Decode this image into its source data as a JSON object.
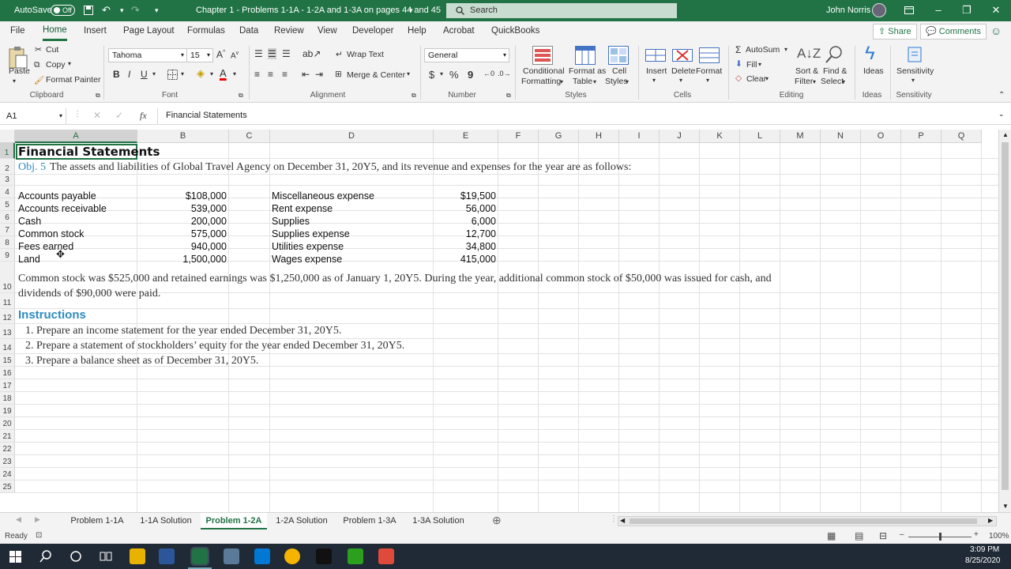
{
  "title_bar": {
    "autosave_label": "AutoSave",
    "autosave_state": "Off",
    "document_title": "Chapter 1 - Problems 1-1A - 1-2A and 1-3A on pages 44 and 45",
    "search_placeholder": "Search",
    "user_name": "John Norris"
  },
  "ribbon_tabs": [
    "File",
    "Home",
    "Insert",
    "Page Layout",
    "Formulas",
    "Data",
    "Review",
    "View",
    "Developer",
    "Help",
    "Acrobat",
    "QuickBooks"
  ],
  "active_tab": "Home",
  "share_label": "Share",
  "comments_label": "Comments",
  "ribbon": {
    "clipboard": {
      "paste": "Paste",
      "cut": "Cut",
      "copy": "Copy",
      "format_painter": "Format Painter",
      "group": "Clipboard"
    },
    "font": {
      "name": "Tahoma",
      "size": "15",
      "bold": "B",
      "italic": "I",
      "underline": "U",
      "group": "Font"
    },
    "alignment": {
      "wrap_text": "Wrap Text",
      "merge_center": "Merge & Center",
      "group": "Alignment"
    },
    "number": {
      "format": "General",
      "currency": "$",
      "percent": "%",
      "comma": "9",
      "group": "Number"
    },
    "styles": {
      "conditional": "Conditional",
      "conditional2": "Formatting",
      "format_as": "Format as",
      "format_as2": "Table",
      "cell": "Cell",
      "cell2": "Styles",
      "group": "Styles"
    },
    "cells": {
      "insert": "Insert",
      "delete": "Delete",
      "format": "Format",
      "group": "Cells"
    },
    "editing": {
      "autosum": "AutoSum",
      "fill": "Fill",
      "clear": "Clear",
      "sort": "Sort &",
      "sort2": "Filter",
      "find": "Find &",
      "find2": "Select",
      "group": "Editing"
    },
    "ideas": {
      "label": "Ideas",
      "group": "Ideas"
    },
    "sensitivity": {
      "label": "Sensitivity",
      "group": "Sensitivity"
    }
  },
  "formula_bar": {
    "name_box": "A1",
    "fx": "fx",
    "content": "Financial Statements"
  },
  "columns": [
    "A",
    "B",
    "C",
    "D",
    "E",
    "F",
    "G",
    "H",
    "I",
    "J",
    "K",
    "L",
    "M",
    "N",
    "O",
    "P",
    "Q"
  ],
  "rows": [
    "1",
    "2",
    "3",
    "4",
    "5",
    "6",
    "7",
    "8",
    "9",
    "10",
    "11",
    "12",
    "13",
    "14",
    "15",
    "16",
    "17",
    "18",
    "19",
    "20",
    "21",
    "22",
    "23",
    "24",
    "25"
  ],
  "sheet": {
    "a1": "Financial Statements",
    "a2_obj": "Obj. 5",
    "a2_text": "The assets and liabilities of Global Travel Agency on December 31, 20Y5, and its revenue and expenses for the year are as follows:",
    "left_items": [
      {
        "label": "Accounts payable",
        "value": "$108,000"
      },
      {
        "label": "Accounts receivable",
        "value": "539,000"
      },
      {
        "label": "Cash",
        "value": "200,000"
      },
      {
        "label": "Common stock",
        "value": "575,000"
      },
      {
        "label": "Fees earned",
        "value": "940,000"
      },
      {
        "label": "Land",
        "value": "1,500,000"
      }
    ],
    "right_items": [
      {
        "label": "Miscellaneous expense",
        "value": "$19,500"
      },
      {
        "label": "Rent expense",
        "value": "56,000"
      },
      {
        "label": "Supplies",
        "value": "6,000"
      },
      {
        "label": "Supplies expense",
        "value": "12,700"
      },
      {
        "label": "Utilities expense",
        "value": "34,800"
      },
      {
        "label": "Wages expense",
        "value": "415,000"
      }
    ],
    "a10_line1": "Common stock was $525,000 and retained earnings was $1,250,000 as of January 1, 20Y5. During the year, additional common stock of $50,000 was issued for cash, and",
    "a10_line2": "dividends of $90,000 were paid.",
    "a11": "Instructions",
    "instructions": [
      "1. Prepare an income statement for the year ended December 31, 20Y5.",
      "2. Prepare a statement of stockholders’ equity for the year ended December 31, 20Y5.",
      "3. Prepare a balance sheet as of December 31, 20Y5."
    ]
  },
  "sheet_tabs": [
    "Problem 1-1A",
    "1-1A Solution",
    "Problem 1-2A",
    "1-2A Solution",
    "Problem 1-3A",
    "1-3A Solution"
  ],
  "active_sheet": "Problem 1-2A",
  "status": {
    "ready": "Ready",
    "zoom": "100%"
  },
  "taskbar": {
    "time": "3:09 PM",
    "date": "8/25/2020"
  },
  "colors": {
    "excel_green": "#217346",
    "accent_blue": "#2e8bc0"
  }
}
